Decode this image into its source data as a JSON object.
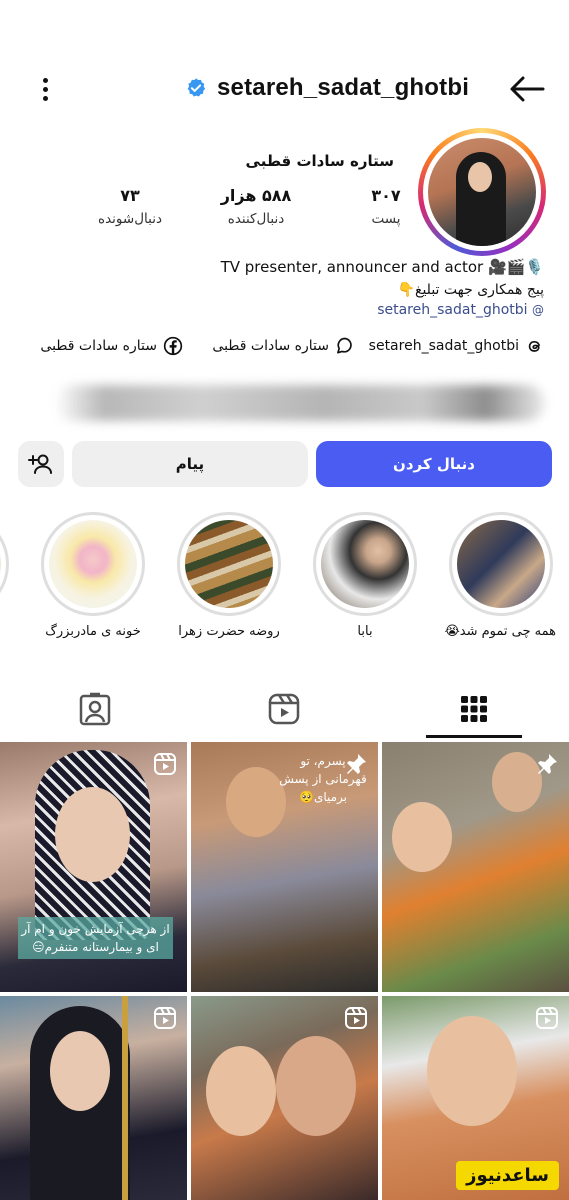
{
  "header": {
    "username": "setareh_sadat_ghotbi",
    "back_icon": "arrow-left-icon",
    "menu_icon": "more-vertical-icon",
    "verified_color": "#3897f0"
  },
  "profile": {
    "full_name": "ستاره سادات قطبی",
    "stats": [
      {
        "number": "۳۰۷",
        "label": "پست"
      },
      {
        "number": "۵۸۸ هزار",
        "label": "دنبال‌کننده"
      },
      {
        "number": "۷۳",
        "label": "دنبال‌شونده"
      }
    ],
    "bio_line1": "TV presenter, announcer and actor 🎥🎬🎙️",
    "bio_line2": "پیج همکاری جهت تبلیغ👇",
    "bio_link": "setareh_sadat_ghotbi"
  },
  "links": {
    "threads": "setareh_sadat_ghotbi",
    "chat": "ستاره سادات قطبی",
    "facebook": "ستاره سادات قطبی"
  },
  "buttons": {
    "follow": "دنبال کردن",
    "message": "پیام",
    "follow_color": "#4a5cf2"
  },
  "highlights": [
    {
      "caption": "همه چی تموم شد😭"
    },
    {
      "caption": "بابا"
    },
    {
      "caption": "روضه حضرت زهرا"
    },
    {
      "caption": "خونه ی مادربزرگ"
    }
  ],
  "posts": {
    "post1_text": "از هرچی آزمایش خون و ام آر ای و بیمارستانه متنفرم😑",
    "post2_text": "پسرم، تو قهرمانی از پسش برمیای🥺",
    "watermark": "ساعدنیوز"
  }
}
